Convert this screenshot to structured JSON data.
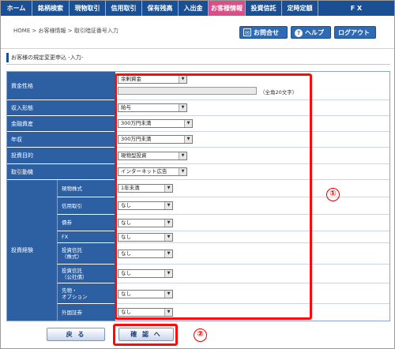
{
  "nav": {
    "items": [
      {
        "label": "ホーム"
      },
      {
        "label": "銘柄検索"
      },
      {
        "label": "現物取引"
      },
      {
        "label": "信用取引"
      },
      {
        "label": "保有残高"
      },
      {
        "label": "入出金"
      },
      {
        "label": "お客様情報"
      },
      {
        "label": "投資信託"
      },
      {
        "label": "定時定額"
      },
      {
        "label": "F X"
      }
    ],
    "active_color": "#d94f8a",
    "bar_color": "#1b4f93"
  },
  "breadcrumb": "HOME > お客様情報 > 取引暗証番号入力",
  "header_buttons": {
    "contact": "お問合せ",
    "help": "ヘルプ",
    "logout": "ログアウト"
  },
  "section_title": "お客様の規定変更申込 -入力-",
  "form": {
    "fund_nature": {
      "label": "資金性格",
      "value": "余剰資金",
      "hint": "（全角20文字）"
    },
    "income_type": {
      "label": "収入形態",
      "value": "給与"
    },
    "financial_assets": {
      "label": "金融資産",
      "value": "300万円未満"
    },
    "annual_income": {
      "label": "年収",
      "value": "300万円未満"
    },
    "investment_purpose": {
      "label": "投資目的",
      "value": "現物型投資"
    },
    "trading_motive": {
      "label": "取引動機",
      "value": "インターネット広告"
    },
    "experience": {
      "label": "投資経験",
      "rows": [
        {
          "label": "現物株式",
          "value": "1年未満"
        },
        {
          "label": "信用取引",
          "value": "なし"
        },
        {
          "label": "債券",
          "value": "なし"
        },
        {
          "label": "FX",
          "value": "なし"
        },
        {
          "label": "投資信託\n（株式）",
          "value": "なし"
        },
        {
          "label": "投資信託\n（公社債）",
          "value": "なし"
        },
        {
          "label": "先物・\nオプション",
          "value": "なし"
        },
        {
          "label": "外国証券",
          "value": "なし"
        }
      ]
    }
  },
  "annotations": {
    "one": "①",
    "two": "②",
    "color": "#ff0a0a"
  },
  "buttons": {
    "back": "戻 る",
    "confirm": "確 認 へ"
  }
}
